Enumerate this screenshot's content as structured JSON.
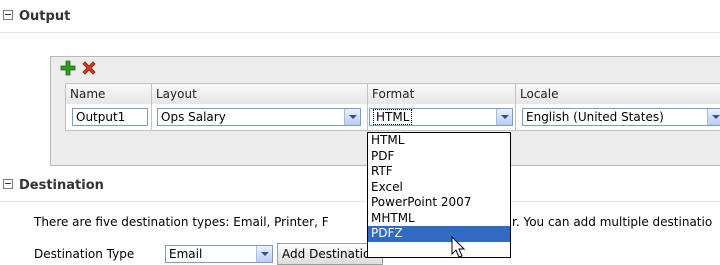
{
  "sections": {
    "output": "Output",
    "destination": "Destination"
  },
  "toolbar": {
    "add_icon": "green-plus-icon",
    "delete_icon": "red-x-icon"
  },
  "table": {
    "columns": [
      "Name",
      "Layout",
      "Format",
      "Locale"
    ],
    "row": {
      "name": "Output1",
      "layout": "Ops Salary",
      "format": "HTML",
      "locale": "English (United States)"
    }
  },
  "format_dropdown": {
    "options": [
      "HTML",
      "PDF",
      "RTF",
      "Excel",
      "PowerPoint 2007",
      "MHTML",
      "PDFZ"
    ],
    "highlighted": "PDFZ"
  },
  "destination": {
    "description_start": "There are five destination types: Email, Printer, F",
    "description_end": "r. You can add multiple destinatio",
    "type_label": "Destination Type",
    "type_value": "Email",
    "add_button": "Add Destination"
  },
  "colors": {
    "selection": "#316ac5",
    "add": "#2e9a1e",
    "delete": "#d63a1b"
  }
}
